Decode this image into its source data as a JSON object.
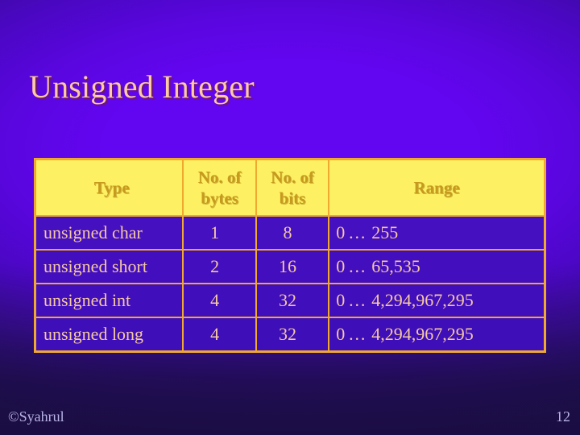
{
  "slide": {
    "title": "Unsigned Integer",
    "page_number": "12",
    "credit": "©Syahrul",
    "colors": {
      "background_center": "#6205f0",
      "background_edge": "#1d0f49",
      "title_text": "#fbc9a4",
      "table_border": "#f0a830",
      "header_background": "#fdf163",
      "header_text": "#c79a1e",
      "cell_background": "#4410c0",
      "cell_text": "#f6c9a3",
      "footer_text": "#b9b4e8"
    }
  },
  "table": {
    "headers": {
      "type": "Type",
      "bytes": "No. of bytes",
      "bits": "No. of bits",
      "range": "Range"
    },
    "rows": [
      {
        "type": "unsigned char",
        "bytes": "1",
        "bits": "8",
        "range_low": "0",
        "range_sep": "…",
        "range_high": "255"
      },
      {
        "type": "unsigned short",
        "bytes": "2",
        "bits": "16",
        "range_low": "0",
        "range_sep": "…",
        "range_high": "65,535"
      },
      {
        "type": "unsigned int",
        "bytes": "4",
        "bits": "32",
        "range_low": "0",
        "range_sep": "…",
        "range_high": "4,294,967,295"
      },
      {
        "type": "unsigned long",
        "bytes": "4",
        "bits": "32",
        "range_low": "0",
        "range_sep": "…",
        "range_high": "4,294,967,295"
      }
    ]
  }
}
